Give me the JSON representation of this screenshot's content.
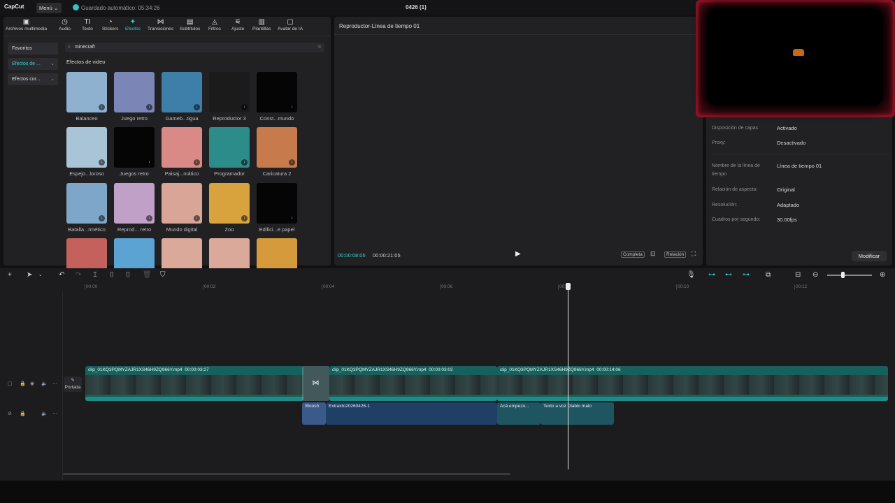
{
  "app": {
    "logo": "CapCut",
    "menu_label": "Menú",
    "autosave": "Guardado automático: 05:34:26",
    "project_title": "0426 (1)"
  },
  "toolbar": [
    {
      "label": "Archivos multimedia",
      "icon": "media-icon",
      "glyph": "▣"
    },
    {
      "label": "Audio",
      "icon": "audio-icon",
      "glyph": "◷"
    },
    {
      "label": "Texto",
      "icon": "text-icon",
      "glyph": "TI"
    },
    {
      "label": "Stickers",
      "icon": "sticker-icon",
      "glyph": "◔"
    },
    {
      "label": "Efectos",
      "icon": "effects-icon",
      "glyph": "✦"
    },
    {
      "label": "Transiciones",
      "icon": "transitions-icon",
      "glyph": "⋈"
    },
    {
      "label": "Subtítulos",
      "icon": "subtitles-icon",
      "glyph": "▤"
    },
    {
      "label": "Filtros",
      "icon": "filters-icon",
      "glyph": "◬"
    },
    {
      "label": "Ajuste",
      "icon": "adjust-icon",
      "glyph": "⚟"
    },
    {
      "label": "Plantillas",
      "icon": "templates-icon",
      "glyph": "▥"
    },
    {
      "label": "Avatar de IA",
      "icon": "ai-avatar-icon",
      "glyph": "▢"
    }
  ],
  "categories": {
    "favorites": "Favoritos",
    "video": "Efectos de ...",
    "body": "Efectos cor..."
  },
  "search": {
    "value": "minecraft"
  },
  "section_title": "Efectos de video",
  "effects": [
    {
      "label": "Balanceo",
      "color": "#8fb1d0"
    },
    {
      "label": "Juego retro",
      "color": "#7c86b6"
    },
    {
      "label": "Gameb...tigua",
      "color": "#3d7fa8"
    },
    {
      "label": "Reproductor 3",
      "color": "#1b1b1b"
    },
    {
      "label": "Const...mundo",
      "color": "#050505"
    },
    {
      "label": "Espejo...loroso",
      "color": "#a9c4d6"
    },
    {
      "label": "Juegos retro",
      "color": "#050505"
    },
    {
      "label": "Paisaj...mático",
      "color": "#d98a86"
    },
    {
      "label": "Programador",
      "color": "#2b8c89"
    },
    {
      "label": "Caricatura 2",
      "color": "#c77a4c"
    },
    {
      "label": "Batalla...rmético",
      "color": "#7ea6c8"
    },
    {
      "label": "Reprod... retro",
      "color": "#c1a0c8"
    },
    {
      "label": "Mundo digital",
      "color": "#d9a596"
    },
    {
      "label": "Zoo",
      "color": "#d8a23d"
    },
    {
      "label": "Edifici...e papel",
      "color": "#050505"
    },
    {
      "label": "",
      "color": "#c4615c"
    },
    {
      "label": "",
      "color": "#5aa3d2"
    },
    {
      "label": "",
      "color": "#dba99a"
    },
    {
      "label": "",
      "color": "#dba99a"
    },
    {
      "label": "",
      "color": "#d59a3c"
    }
  ],
  "player": {
    "title": "Reproductor-Línea de tiempo 01",
    "time_current": "00:00:08:05",
    "time_total": "00:00:21:05",
    "full_label": "Completa",
    "ratio_label": "Relación"
  },
  "properties": [
    {
      "label": "Disposición de capas",
      "value": "Activado"
    },
    {
      "label": "Proxy:",
      "value": "Desactivado"
    },
    {
      "label": "Nombre de la línea de tiempo",
      "value": "Línea de tiempo 01"
    },
    {
      "label": "Relación de aspecto:",
      "value": "Original"
    },
    {
      "label": "Resolución:",
      "value": "Adaptado"
    },
    {
      "label": "Cuadros por segundo:",
      "value": "30.00fps"
    }
  ],
  "modify_label": "Modificar",
  "ruler": [
    "00:00",
    "00:02",
    "00:04",
    "00:06",
    "00:08",
    "00:10",
    "00:12"
  ],
  "cover_label": "Portada",
  "video_clips": [
    {
      "name": "clip_01KQ3PQMYZAJR1XS46H9ZQ966Y.mp4",
      "duration": "00:00:03:27"
    },
    {
      "name": "clip_01KQ3PQMYZAJR1XS46H9ZQ966Y.mp4",
      "duration": "00:00:03:02"
    },
    {
      "name": "clip_01KQ3PQMYZAJR1XS46H9ZQ966Y.mp4",
      "duration": "00:00:14:06"
    }
  ],
  "audio_clips": [
    {
      "name": "Woosh",
      "color": "#3a5a8a"
    },
    {
      "name": "Extraído20260426-1",
      "color": "#1f3f66"
    },
    {
      "name": "Acá empezo...",
      "color": "#1e5560"
    },
    {
      "name": "Texto a voz Diablo malo",
      "color": "#1e5560"
    }
  ],
  "colors": {
    "accent": "#37d1d1",
    "panel": "#212124"
  }
}
